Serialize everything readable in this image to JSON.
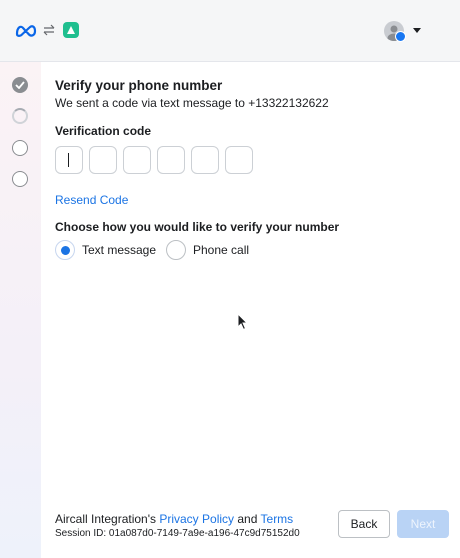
{
  "header": {
    "logo_icon": "meta-logo-icon",
    "swap_icon": "swap-arrows-icon",
    "app_icon": "aircall-app-icon",
    "app_color": "#1fbf8f",
    "avatar_icon": "account-avatar-icon",
    "badge_icon": "facebook-badge-icon",
    "menu_icon": "caret-down-icon"
  },
  "stepper": {
    "steps": [
      {
        "state": "complete",
        "icon": "check-icon"
      },
      {
        "state": "current",
        "icon": "spinner-icon"
      },
      {
        "state": "upcoming",
        "icon": "empty-circle-icon"
      },
      {
        "state": "upcoming",
        "icon": "empty-circle-icon"
      }
    ]
  },
  "main": {
    "title": "Verify your phone number",
    "subtitle": "We sent a code via text message to +13322132622",
    "code_label": "Verification code",
    "code_digits": [
      "",
      "",
      "",
      "",
      "",
      ""
    ],
    "resend_label": "Resend Code",
    "choose_label": "Choose how you would like to verify your number",
    "options": [
      {
        "label": "Text message",
        "selected": true
      },
      {
        "label": "Phone call",
        "selected": false
      }
    ]
  },
  "footer": {
    "prefix": "Aircall Integration's ",
    "privacy_link": "Privacy Policy",
    "and_text": " and ",
    "terms_link": "Terms",
    "session": "Session ID: 01a087d0-7149-7a9e-a196-47c9d75152d0",
    "back_label": "Back",
    "next_label": "Next"
  },
  "colors": {
    "accent": "#1b74e4",
    "next_disabled": "#b9d3f5"
  }
}
